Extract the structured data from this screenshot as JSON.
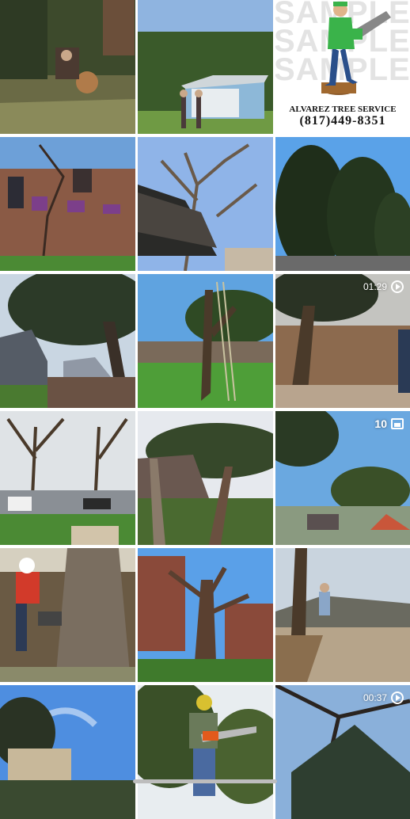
{
  "gallery": {
    "tiles": [
      {
        "scene": "stump"
      },
      {
        "scene": "shed"
      },
      {
        "scene": "logo"
      },
      {
        "scene": "brick-house"
      },
      {
        "scene": "bare-tree"
      },
      {
        "scene": "magnolia"
      },
      {
        "scene": "oak-fence"
      },
      {
        "scene": "ladder-tree"
      },
      {
        "scene": "video-fence"
      },
      {
        "scene": "street"
      },
      {
        "scene": "yard-debris"
      },
      {
        "scene": "carousel-yard"
      },
      {
        "scene": "chainsaw-trunk"
      },
      {
        "scene": "cut-tree"
      },
      {
        "scene": "stump-dig"
      },
      {
        "scene": "sky-house"
      },
      {
        "scene": "worker-chainsaw"
      },
      {
        "scene": "video-roof"
      }
    ],
    "video_1_duration": "01:29",
    "carousel_count": "10",
    "video_2_duration": "00:37"
  },
  "logo": {
    "watermark": "SAMPLE",
    "company_name": "ALVAREZ TREE SERVICE",
    "phone": "(817)449-8351",
    "colors": {
      "shirt": "#3ab34a",
      "pants": "#2a4f8a",
      "saw": "#888888"
    }
  },
  "icons": {
    "video": "play-circle-icon",
    "carousel": "gallery-stack-icon"
  }
}
